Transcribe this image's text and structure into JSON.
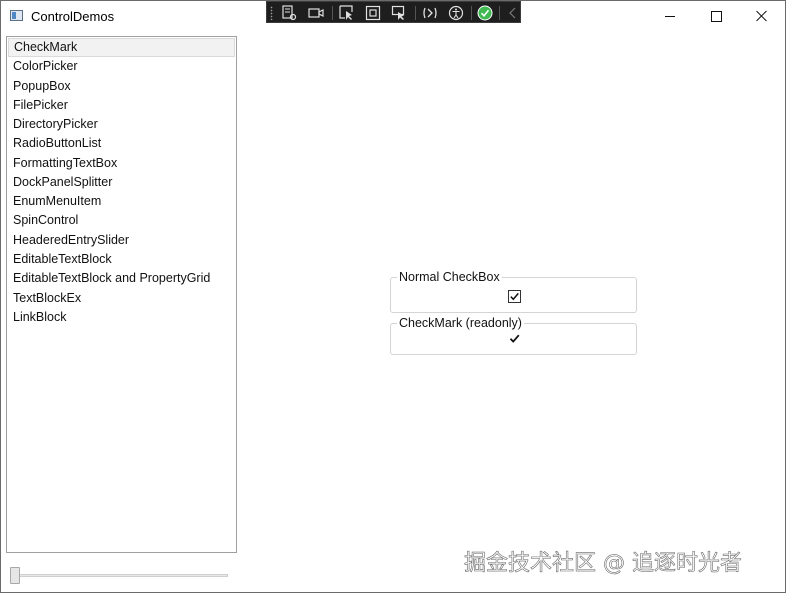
{
  "window": {
    "title": "ControlDemos",
    "icon": "app-window-icon"
  },
  "debug_toolbar": {
    "icons": [
      "grip-icon",
      "live-visual-tree-icon",
      "camera-icon",
      "select-element-icon",
      "display-layout-adorners-icon",
      "track-focus-icon",
      "hot-reload-icon",
      "accessibility-icon",
      "binding-ok-icon",
      "collapse-chevron-icon"
    ]
  },
  "sidebar": {
    "selected_index": 0,
    "items": [
      {
        "label": "CheckMark"
      },
      {
        "label": "ColorPicker"
      },
      {
        "label": "PopupBox"
      },
      {
        "label": "FilePicker"
      },
      {
        "label": "DirectoryPicker"
      },
      {
        "label": "RadioButtonList"
      },
      {
        "label": "FormattingTextBox"
      },
      {
        "label": "DockPanelSplitter"
      },
      {
        "label": "EnumMenuItem"
      },
      {
        "label": "SpinControl"
      },
      {
        "label": "HeaderedEntrySlider"
      },
      {
        "label": "EditableTextBlock"
      },
      {
        "label": "EditableTextBlock and PropertyGrid"
      },
      {
        "label": "TextBlockEx"
      },
      {
        "label": "LinkBlock"
      }
    ]
  },
  "zoom_slider": {
    "value": 0
  },
  "main": {
    "normal_checkbox": {
      "header": "Normal CheckBox",
      "checked": true
    },
    "checkmark_readonly": {
      "header": "CheckMark (readonly)",
      "checked": true
    }
  },
  "watermark": {
    "text": "掘金技术社区 @ 追逐时光者"
  },
  "colors": {
    "text": "#111111",
    "selection_bg": "#f2f2f2",
    "toolbar_bg": "#1e1e1e",
    "ok_green": "#3fb950"
  }
}
